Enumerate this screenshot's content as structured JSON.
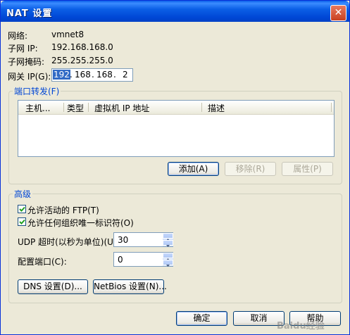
{
  "window": {
    "title": "NAT 设置",
    "close_glyph": "✕"
  },
  "network": {
    "label": "网络:",
    "value": "vmnet8"
  },
  "subnet_ip": {
    "label": "子网 IP:",
    "value": "192.168.168.0"
  },
  "subnet_mask": {
    "label": "子网掩码:",
    "value": "255.255.255.0"
  },
  "gateway": {
    "label": "网关 IP(G):",
    "octets": [
      "192",
      "168",
      "168",
      "2"
    ],
    "dots": [
      "."
    ]
  },
  "port_forwarding": {
    "group_label": "端口转发(F)",
    "columns": [
      "主机...",
      "类型",
      "虚拟机 IP 地址",
      "描述"
    ],
    "add_label": "添加(A)",
    "remove_label": "移除(R)",
    "properties_label": "属性(P)"
  },
  "advanced": {
    "group_label": "高级",
    "allow_ftp": {
      "label": "允许活动的 FTP(T)",
      "checked": true
    },
    "allow_uid": {
      "label": "允许任何组织唯一标识符(O)",
      "checked": true
    },
    "udp_timeout": {
      "label": "UDP 超时(以秒为单位)(U):",
      "value": "30"
    },
    "config_port": {
      "label": "配置端口(C):",
      "value": "0"
    },
    "dns_label": "DNS 设置(D)...",
    "netbios_label": "NetBios 设置(N)..."
  },
  "footer": {
    "ok_label": "确定",
    "cancel_label": "取消",
    "help_label": "帮助"
  },
  "watermark": "Baidu经验"
}
